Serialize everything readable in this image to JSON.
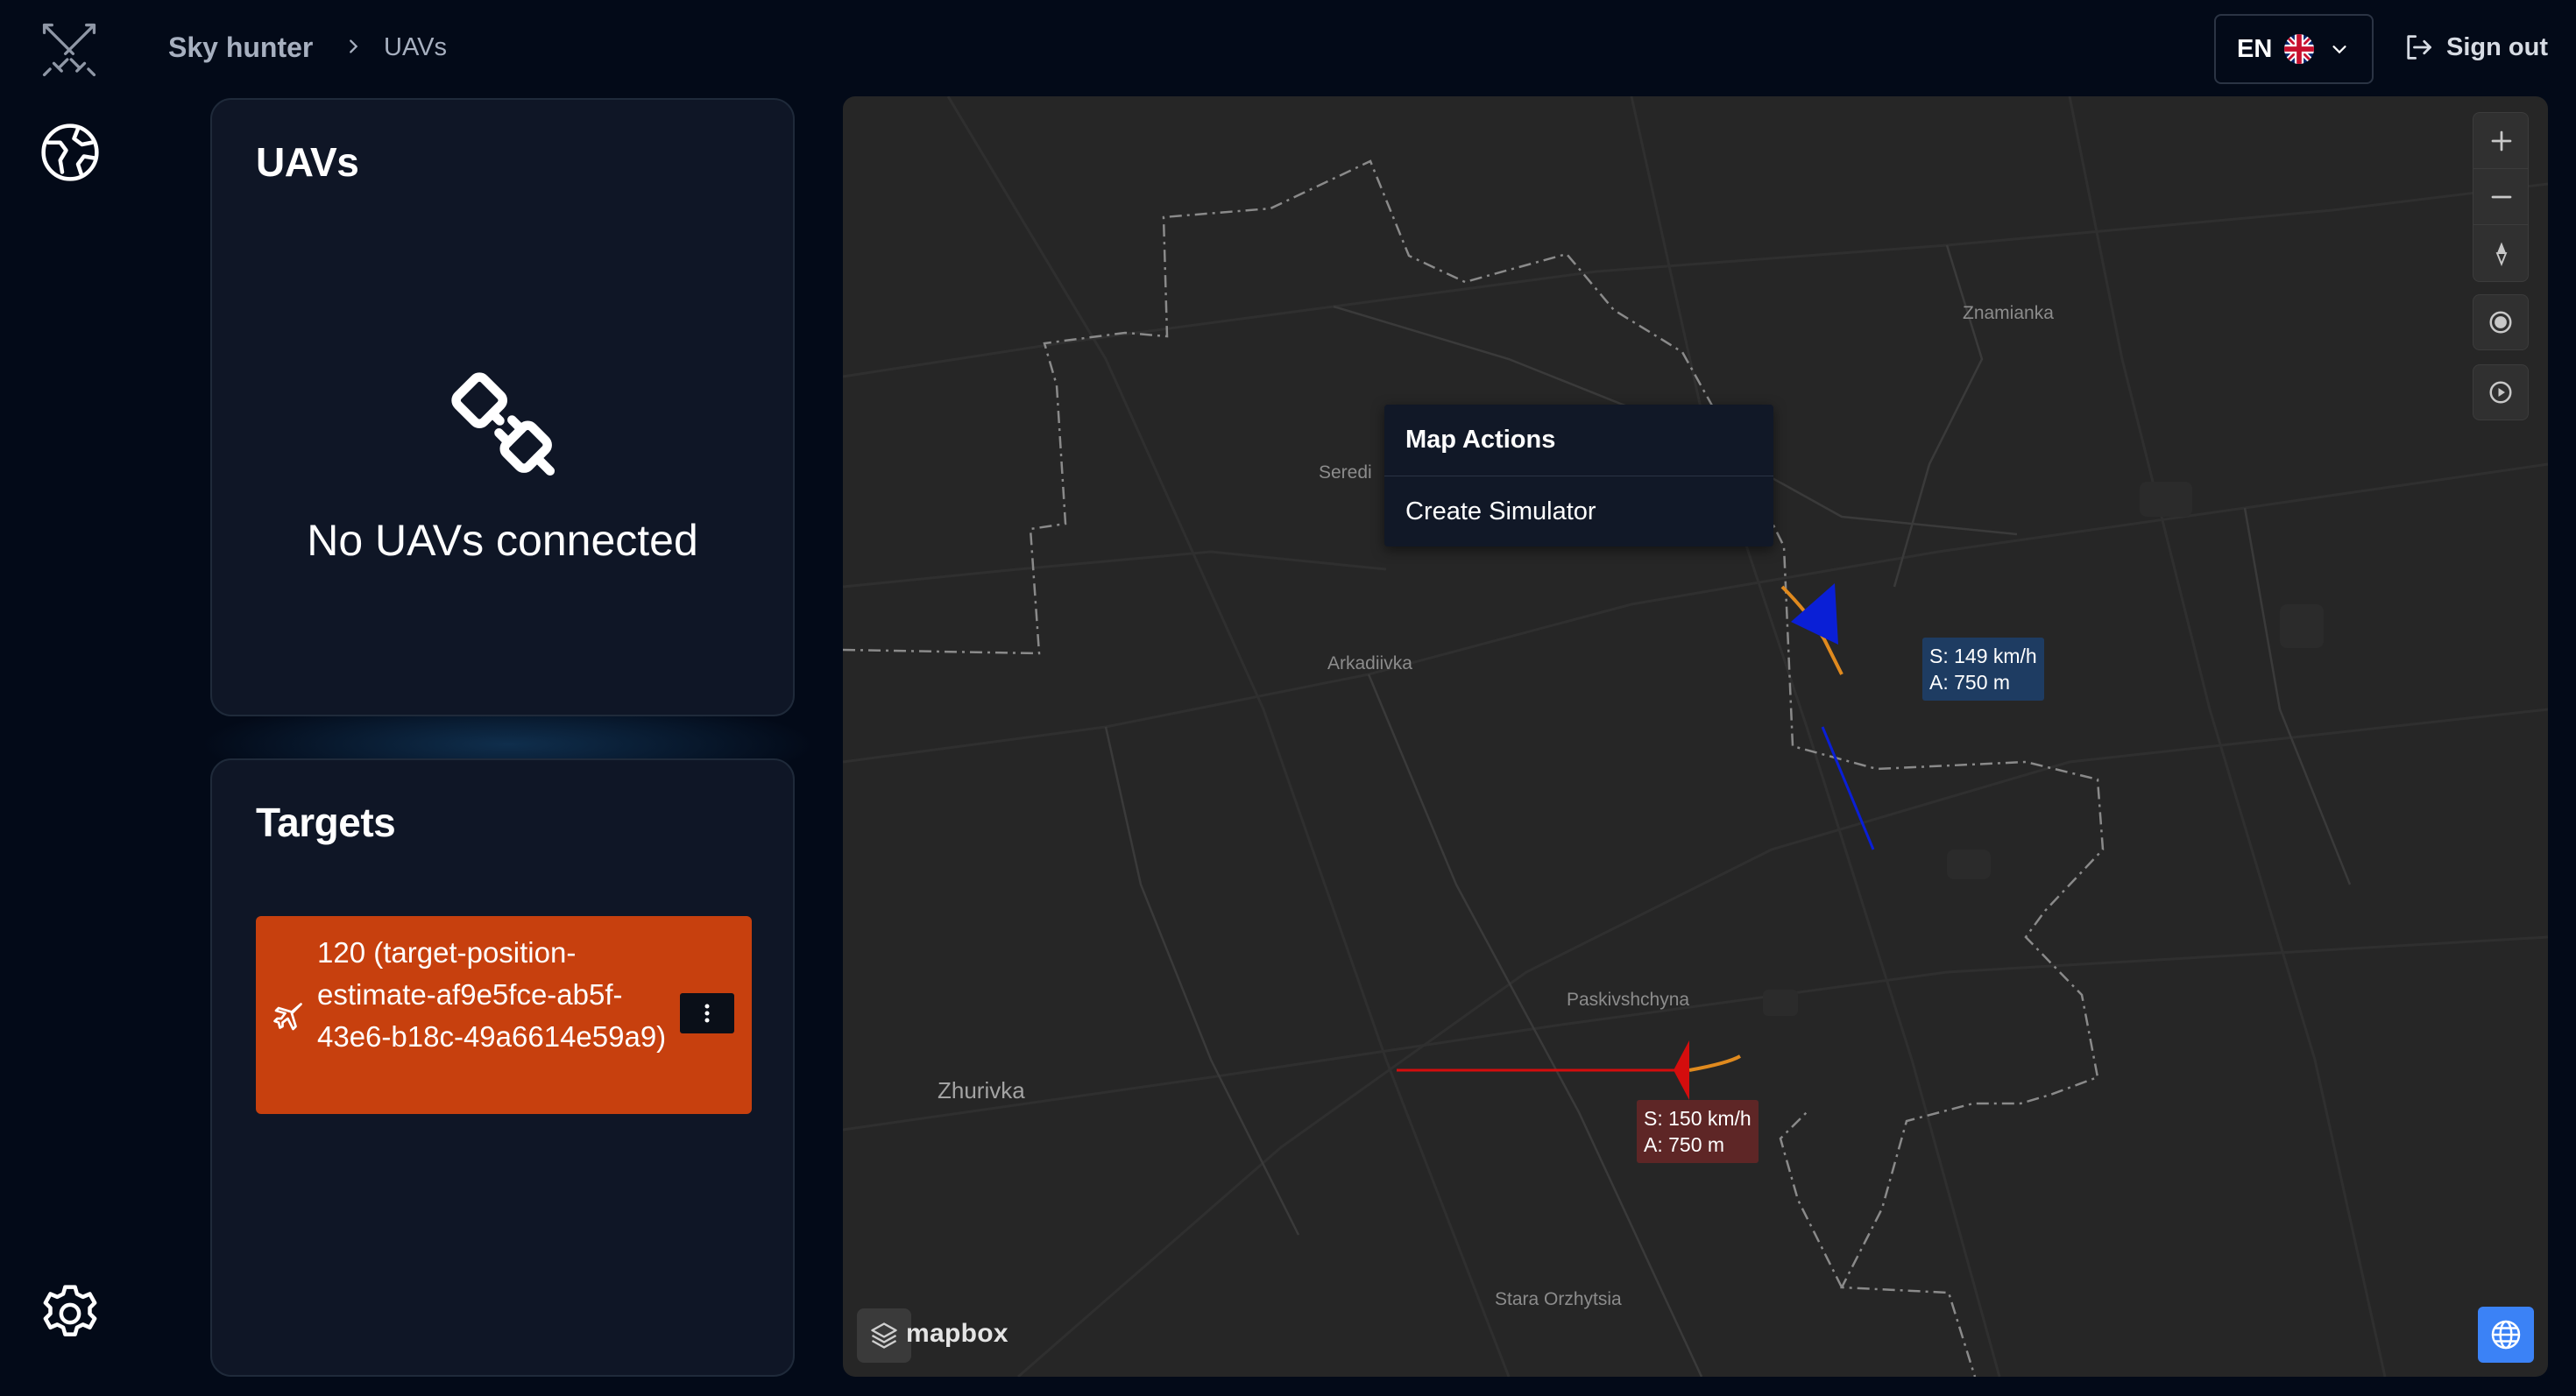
{
  "breadcrumb": {
    "root": "Sky hunter",
    "current": "UAVs"
  },
  "header": {
    "language_code": "EN",
    "language_flag": "uk-flag-icon",
    "sign_out_label": "Sign out"
  },
  "sidebar": {
    "logo_icon": "crossed-swords-icon",
    "nav": [
      "globe-icon",
      "settings-icon"
    ]
  },
  "uavs_panel": {
    "title": "UAVs",
    "empty_icon": "unplugged-icon",
    "empty_text": "No UAVs connected"
  },
  "targets_panel": {
    "title": "Targets",
    "items": [
      {
        "text": "120 (target-position-estimate-af9e5fce-ab5f-43e6-b18c-49a6614e59a9)",
        "icon": "plane-icon",
        "color": "#c7400e"
      }
    ]
  },
  "map": {
    "context_menu": {
      "title": "Map Actions",
      "items": [
        "Create Simulator"
      ]
    },
    "places": [
      "Znamianka",
      "Seredi",
      "Arkadiivka",
      "Paskivshchyna",
      "Zhurivka",
      "Stara Orzhytsia"
    ],
    "uavs": [
      {
        "speed": "S: 149 km/h",
        "altitude": "A: 750 m",
        "color": "#0a1fd6"
      },
      {
        "speed": "S: 150 km/h",
        "altitude": "A: 750 m",
        "color": "#d40d0d"
      }
    ],
    "attribution": "mapbox",
    "controls": [
      "zoom-in-icon",
      "zoom-out-icon",
      "compass-icon",
      "record-icon",
      "play-icon",
      "globe-icon"
    ]
  }
}
